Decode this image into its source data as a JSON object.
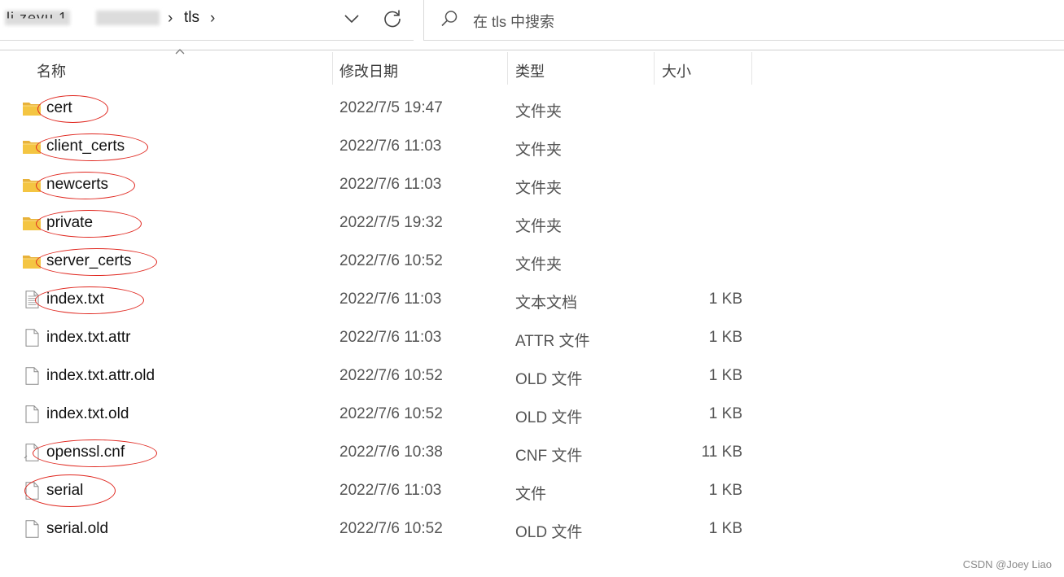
{
  "address_bar": {
    "path_segment_1": "li    zeyu 1",
    "current_folder": "tls",
    "chevron": "›",
    "search_placeholder": "在 tls 中搜索"
  },
  "columns": {
    "name": "名称",
    "modified": "修改日期",
    "type": "类型",
    "size": "大小"
  },
  "files": [
    {
      "name": "cert",
      "modified": "2022/7/5 19:47",
      "type": "文件夹",
      "size": "",
      "icon": "folder-icon",
      "circled": true
    },
    {
      "name": "client_certs",
      "modified": "2022/7/6 11:03",
      "type": "文件夹",
      "size": "",
      "icon": "folder-icon",
      "circled": true
    },
    {
      "name": "newcerts",
      "modified": "2022/7/6 11:03",
      "type": "文件夹",
      "size": "",
      "icon": "folder-icon",
      "circled": true
    },
    {
      "name": "private",
      "modified": "2022/7/5 19:32",
      "type": "文件夹",
      "size": "",
      "icon": "folder-icon",
      "circled": true
    },
    {
      "name": "server_certs",
      "modified": "2022/7/6 10:52",
      "type": "文件夹",
      "size": "",
      "icon": "folder-icon",
      "circled": true
    },
    {
      "name": "index.txt",
      "modified": "2022/7/6 11:03",
      "type": "文本文档",
      "size": "1 KB",
      "icon": "text-file-icon",
      "circled": true
    },
    {
      "name": "index.txt.attr",
      "modified": "2022/7/6 11:03",
      "type": "ATTR 文件",
      "size": "1 KB",
      "icon": "file-icon",
      "circled": false
    },
    {
      "name": "index.txt.attr.old",
      "modified": "2022/7/6 10:52",
      "type": "OLD 文件",
      "size": "1 KB",
      "icon": "file-icon",
      "circled": false
    },
    {
      "name": "index.txt.old",
      "modified": "2022/7/6 10:52",
      "type": "OLD 文件",
      "size": "1 KB",
      "icon": "file-icon",
      "circled": false
    },
    {
      "name": "openssl.cnf",
      "modified": "2022/7/6 10:38",
      "type": "CNF 文件",
      "size": "11 KB",
      "icon": "config-file-icon",
      "circled": true
    },
    {
      "name": "serial",
      "modified": "2022/7/6 11:03",
      "type": "文件",
      "size": "1 KB",
      "icon": "file-icon",
      "circled": true
    },
    {
      "name": "serial.old",
      "modified": "2022/7/6 10:52",
      "type": "OLD 文件",
      "size": "1 KB",
      "icon": "file-icon",
      "circled": false
    }
  ],
  "watermark": "CSDN @Joey Liao",
  "colors": {
    "annotation": "#e0271f",
    "folder": "#f4c542"
  }
}
